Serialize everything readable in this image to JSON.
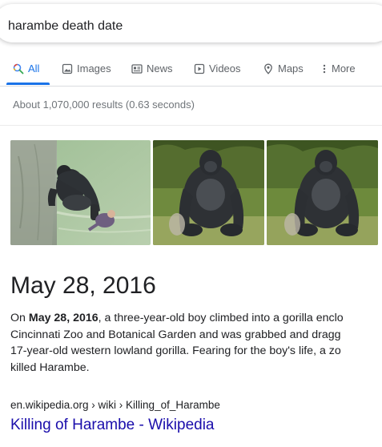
{
  "search": {
    "query": "harambe death date"
  },
  "tabs": [
    {
      "label": "All",
      "icon": "search-icon",
      "active": true
    },
    {
      "label": "Images",
      "icon": "image-icon"
    },
    {
      "label": "News",
      "icon": "news-icon"
    },
    {
      "label": "Videos",
      "icon": "video-play-icon"
    },
    {
      "label": "Maps",
      "icon": "map-pin-icon"
    },
    {
      "label": "More",
      "icon": "more-vertical-icon"
    }
  ],
  "result_stats": "About 1,070,000 results (0.63 seconds)",
  "images": [
    {
      "description": "gorilla with boy in moat"
    },
    {
      "description": "gorilla sitting on grass"
    },
    {
      "description": "gorilla sitting on grass"
    }
  ],
  "answer": {
    "title": "May 28, 2016",
    "snippet_lines": [
      {
        "before": "On ",
        "bold": "May 28, 2016",
        "after": ", a three-year-old boy climbed into a gorilla enclo"
      },
      {
        "text": "Cincinnati Zoo and Botanical Garden and was grabbed and dragg"
      },
      {
        "text": "17-year-old western lowland gorilla. Fearing for the boy's life, a zo"
      },
      {
        "text": "killed Harambe."
      }
    ],
    "source_cite": "en.wikipedia.org › wiki › Killing_of_Harambe",
    "result_title": "Killing of Harambe - Wikipedia"
  },
  "colors": {
    "link": "#1a0dab",
    "accent": "#1a73e8",
    "muted": "#70757a"
  }
}
